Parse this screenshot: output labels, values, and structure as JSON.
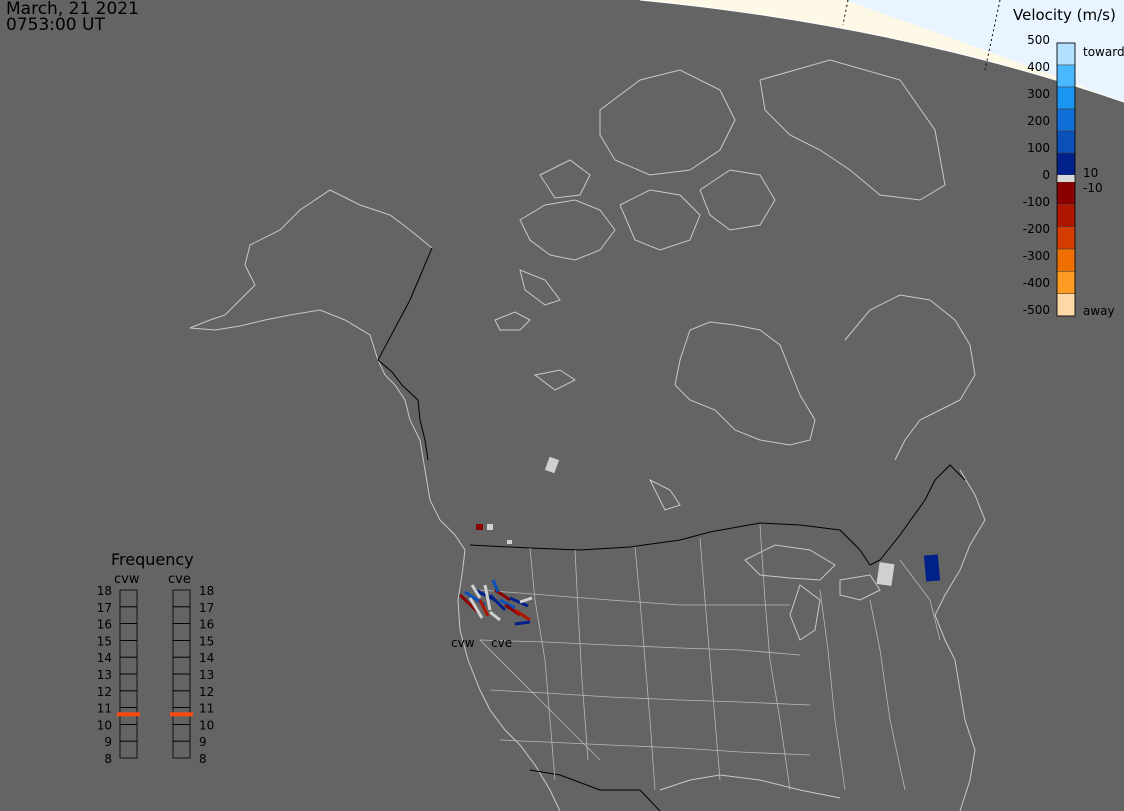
{
  "header": {
    "date": "March, 21 2021",
    "time": "0753:00 UT"
  },
  "velocity_legend": {
    "title": "Velocity (m/s)",
    "ticks": [
      "500",
      "400",
      "300",
      "200",
      "100",
      "0",
      "-100",
      "-200",
      "-300",
      "-400",
      "-500"
    ],
    "toward_label": "toward",
    "away_label": "away",
    "gap_pos_label": "10",
    "gap_neg_label": "-10",
    "colors": [
      "#b3e0ff",
      "#4ab8ff",
      "#1a96f0",
      "#1070d8",
      "#0a50b8",
      "#00208a",
      "#8a0000",
      "#b01500",
      "#d43d00",
      "#ee6e00",
      "#ff9a22",
      "#ffd8a8"
    ]
  },
  "frequency_panel": {
    "title": "Frequency",
    "radars": [
      "cvw",
      "cve"
    ],
    "scale": [
      "18",
      "17",
      "16",
      "15",
      "14",
      "13",
      "12",
      "11",
      "10",
      "9",
      "8"
    ],
    "cvw_freq_mhz": 10.6,
    "cve_freq_mhz": 10.6,
    "marker_color": "#ff4a10"
  },
  "map": {
    "day_color": "#fdf9e6",
    "twilight_color": "#e8f4ff",
    "night_color": "#646464",
    "coast_color": "#c8c8c8",
    "border_color": "#000000",
    "state_color": "#b8b8b8",
    "radar_labels": [
      "cvw",
      "cve"
    ]
  }
}
